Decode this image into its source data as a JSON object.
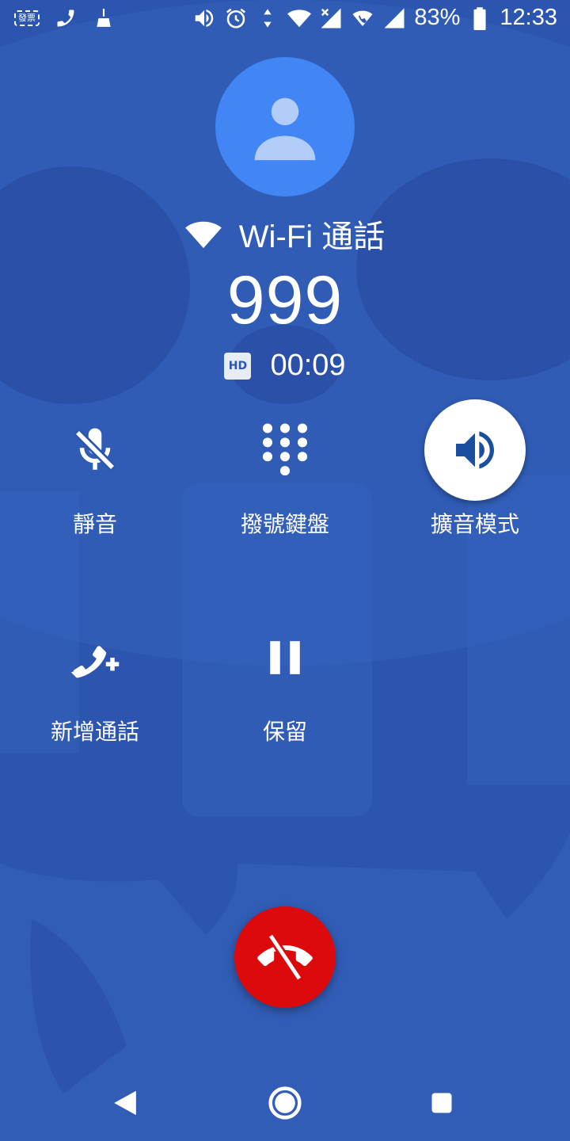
{
  "status_bar": {
    "left_icons": [
      "invoice-ticket-icon",
      "call-icon",
      "broom-icon"
    ],
    "ticket_text": "發票",
    "right_icons": [
      "speaker-icon",
      "alarm-icon",
      "data-arrows-icon",
      "wifi-icon",
      "signal-x-icon",
      "wifi-call-icon",
      "signal-icon",
      "battery-icon"
    ],
    "battery": "83%",
    "time": "12:33"
  },
  "call": {
    "label": "Wi-Fi 通話",
    "number": "999",
    "hd": "HD",
    "duration": "00:09"
  },
  "controls": [
    {
      "label": "靜音",
      "icon": "mic-off-icon",
      "active": false
    },
    {
      "label": "撥號鍵盤",
      "icon": "dialpad-icon",
      "active": false
    },
    {
      "label": "擴音模式",
      "icon": "speaker-icon",
      "active": true
    },
    {
      "label": "新增通話",
      "icon": "add-call-icon",
      "active": false
    },
    {
      "label": "保留",
      "icon": "pause-icon",
      "active": false
    }
  ],
  "colors": {
    "background": "#2c55b0",
    "avatar": "#4285f4",
    "end_call": "#dc0a0a",
    "active_icon": "#1a4fa0"
  },
  "nav": [
    "back-icon",
    "home-icon",
    "recents-icon"
  ]
}
